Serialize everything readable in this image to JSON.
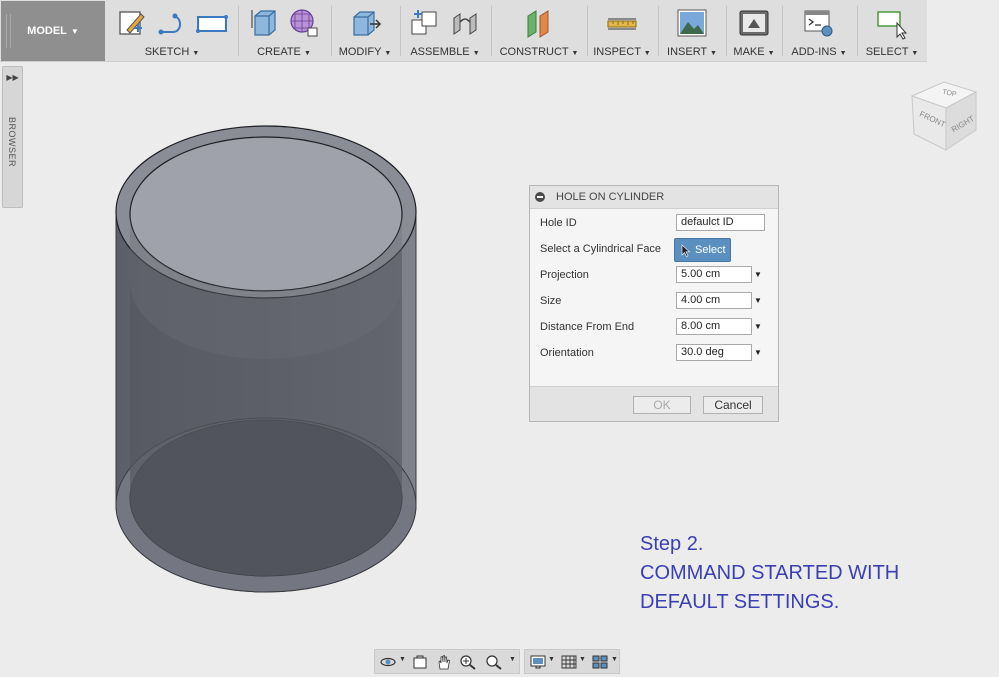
{
  "toolbar": {
    "mode": "MODEL",
    "groups": [
      {
        "label": "SKETCH"
      },
      {
        "label": "CREATE"
      },
      {
        "label": "MODIFY"
      },
      {
        "label": "ASSEMBLE"
      },
      {
        "label": "CONSTRUCT"
      },
      {
        "label": "INSPECT"
      },
      {
        "label": "INSERT"
      },
      {
        "label": "MAKE"
      },
      {
        "label": "ADD-INS"
      },
      {
        "label": "SELECT"
      }
    ]
  },
  "browser": {
    "label": "BROWSER"
  },
  "viewcube": {
    "top": "TOP",
    "front": "FRONT",
    "right": "RIGHT"
  },
  "dialog": {
    "title": "HOLE ON CYLINDER",
    "hole_id": {
      "label": "Hole ID",
      "value": "defaulct ID"
    },
    "face": {
      "label": "Select a Cylindrical Face",
      "button": "Select"
    },
    "projection": {
      "label": "Projection",
      "value": "5.00 cm"
    },
    "size": {
      "label": "Size",
      "value": "4.00 cm"
    },
    "distance": {
      "label": "Distance From End",
      "value": "8.00 cm"
    },
    "orientation": {
      "label": "Orientation",
      "value": "30.0 deg"
    },
    "ok": "OK",
    "cancel": "Cancel"
  },
  "annotation": {
    "line1": "Step 2.",
    "line2": "COMMAND STARTED WITH",
    "line3": "DEFAULT SETTINGS."
  },
  "colors": {
    "accent": "#5a8fc0",
    "annotation": "#3a3fb3"
  }
}
